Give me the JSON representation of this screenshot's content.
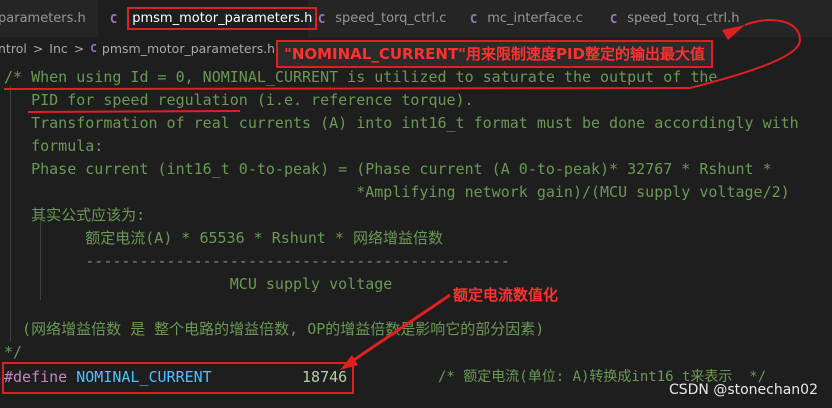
{
  "tabs": [
    {
      "label": "parameters.h",
      "icon": "c-file-icon"
    },
    {
      "label": "pmsm_motor_parameters.h",
      "icon": "c-file-icon",
      "active": true,
      "modified": true
    },
    {
      "label": "speed_torq_ctrl.c",
      "icon": "c-file-icon"
    },
    {
      "label": "mc_interface.c",
      "icon": "c-file-icon"
    },
    {
      "label": "speed_torq_ctrl.h",
      "icon": "c-file-icon"
    }
  ],
  "breadcrumb": {
    "items": [
      "ntrol",
      "Inc",
      "pmsm_motor_parameters.h",
      "..."
    ],
    "separator": ">"
  },
  "code": {
    "lines": [
      "/* When using Id = 0, NOMINAL_CURRENT is utilized to saturate the output of the",
      "   PID for speed regulation (i.e. reference torque).",
      "   Transformation of real currents (A) into int16_t format must be done accordingly with",
      "   formula:",
      "   Phase current (int16_t 0-to-peak) = (Phase current (A 0-to-peak)* 32767 * Rshunt *",
      "                                       *Amplifying network gain)/(MCU supply voltage/2)",
      "   其实公式应该为:",
      "         额定电流(A) * 65536 * Rshunt * 网络增益倍数",
      "         -----------------------------------------------",
      "                         MCU supply voltage",
      "",
      "  (网络增益倍数 是 整个电路的增益倍数, OP的增益倍数是影响它的部分因素)",
      "*/"
    ],
    "define_line": {
      "keyword": "#define",
      "name": "NOMINAL_CURRENT",
      "value": "18746",
      "comment": "/* 额定电流(单位: A)转换成int16_t来表示  */"
    }
  },
  "annotations": {
    "callout_top": "\"NOMINAL_CURRENT\"用来限制速度PID整定的输出最大值",
    "callout_value": "额定电流数值化"
  },
  "watermark": "CSDN @stonechan02",
  "colors": {
    "editor_bg": "#1e1e1e",
    "comment": "#6a9955",
    "keyword": "#c586c0",
    "macro": "#4fc1ff",
    "number": "#b5cea8",
    "annotation_red": "#e02020"
  }
}
